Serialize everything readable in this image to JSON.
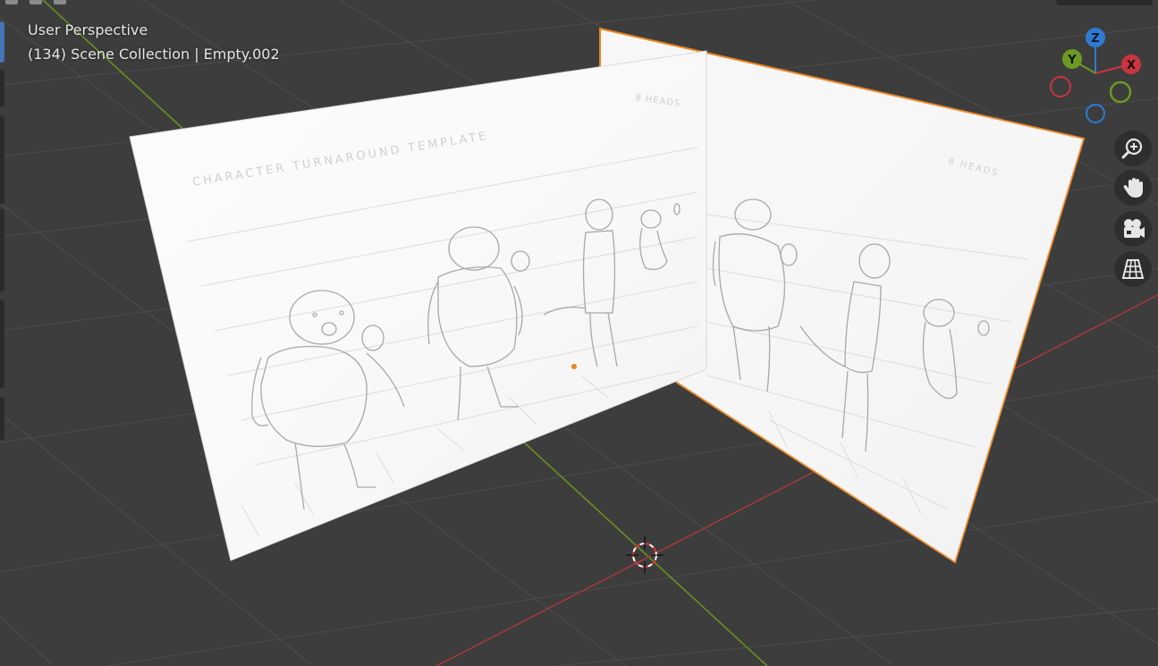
{
  "viewport": {
    "view_mode": "User Perspective",
    "context_line": "(134) Scene Collection | Empty.002"
  },
  "reference_sheet": {
    "front_plane_title": "CHARACTER TURNAROUND TEMPLATE",
    "back_plane_label_left": "8 HEADS",
    "back_plane_label_right": "8 HEADS"
  },
  "gizmo": {
    "z_label": "Z",
    "y_label": "Y",
    "x_label": "X",
    "colors": {
      "x": "#c9353f",
      "y": "#6b9b22",
      "z": "#2e7bd1"
    }
  },
  "nav_buttons": [
    {
      "name": "zoom",
      "icon": "zoom-in-icon"
    },
    {
      "name": "pan",
      "icon": "hand-icon"
    },
    {
      "name": "camera",
      "icon": "camera-icon"
    },
    {
      "name": "ortho",
      "icon": "grid-icon"
    }
  ],
  "colors": {
    "background": "#3d3d3d",
    "grid": "#4a4a4a",
    "x_axis": "#a03a3a",
    "y_axis": "#6b8f1f",
    "selection": "#e8831f",
    "active_tab": "#4772b3"
  }
}
